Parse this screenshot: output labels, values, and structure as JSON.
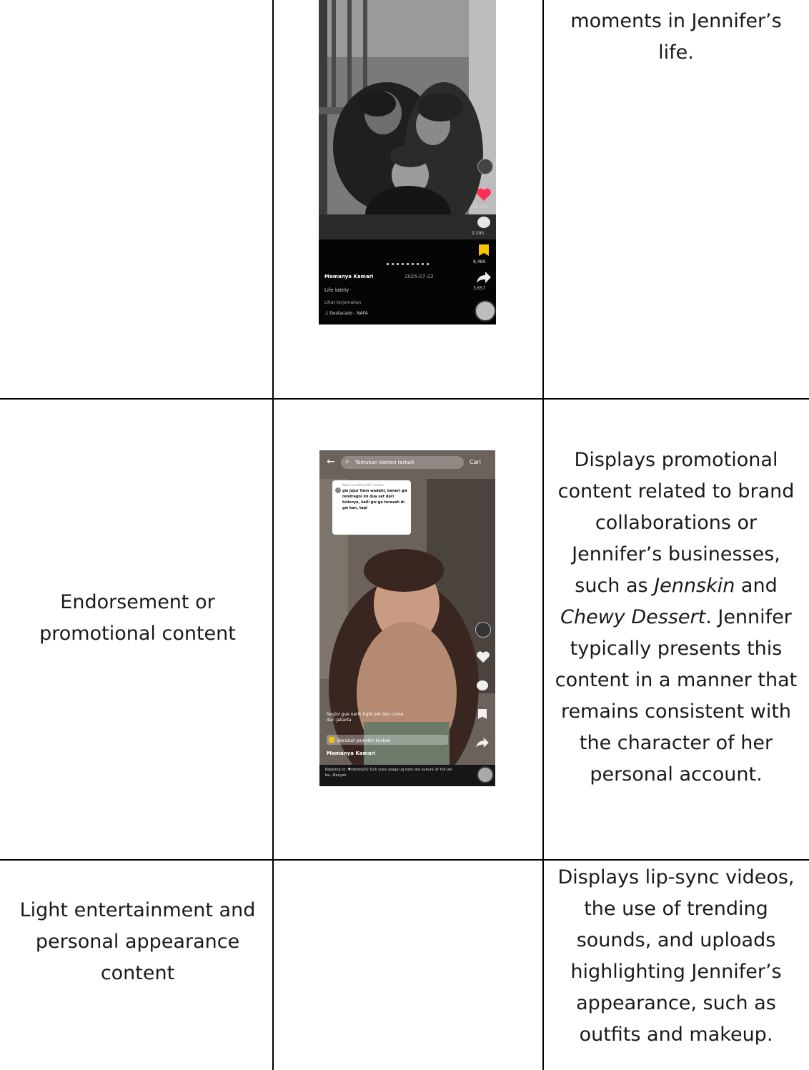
{
  "rows": [
    {
      "category": "",
      "description": "moments in Jennifer’s life."
    },
    {
      "category": "Endorsement or promotional content",
      "description_parts": {
        "a": "Displays promotional content related to brand collaborations or Jennifer’s businesses, such as ",
        "brand1": "Jennskin",
        "b": " and ",
        "brand2": "Chewy Dessert",
        "c": ". Jennifer typically presents this content in a manner that remains consistent with the character of her personal account."
      }
    },
    {
      "category": "Light entertainment and personal appearance content",
      "description": "Displays lip-sync videos, the use of trending sounds, and uploads highlighting Jennifer’s appearance, such as outfits and makeup."
    }
  ],
  "shot1": {
    "likes": "722,736",
    "comments": "2,295",
    "saves": "8,489",
    "shares": "3,657",
    "username": "Mamanya Kamari",
    "date": "2025-07-22",
    "caption": "Life lately",
    "translate": "Lihat terjemahan",
    "music": "♫ Destacado - NAFA"
  },
  "shot2": {
    "search": "Temukan konten terkait",
    "search_button": "Cari",
    "reply_to": "Balas ke stefanyr02's komen",
    "bubble": "gw jujur tiem wadahi, beneri gw rendragni ini dua set dari tulisnya, kalli gw ga terasah di gw kan, tapi",
    "caption_line": "Segini gue narik tight set dan cuma dari Jakarta",
    "promo": "Bersikat Jennskin kaskan",
    "username": "Mamanya Kamari",
    "reply_line": "Replying to: ♥stefany02 Duh suka usaga ug baru ata sukura 😘 Yuk jan ba...Banyak"
  },
  "colors": {
    "border": "#000000",
    "like_red": "#ff2d55",
    "save_yellow": "#f5c400"
  }
}
